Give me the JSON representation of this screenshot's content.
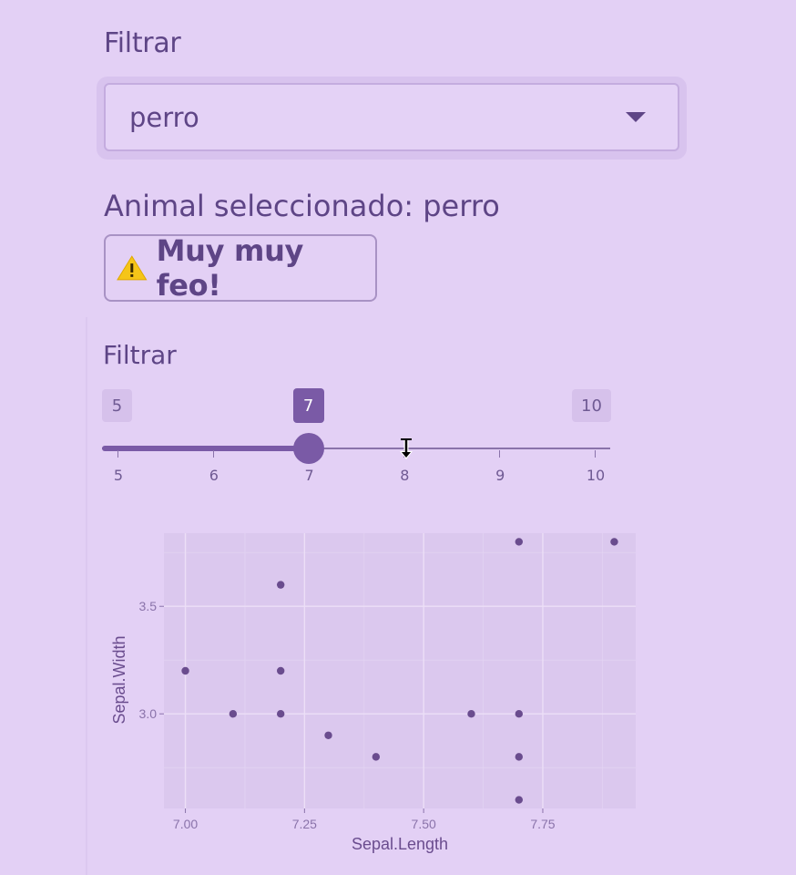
{
  "filter_select": {
    "label": "Filtrar",
    "value": "perro"
  },
  "status": {
    "text": "Animal seleccionado: perro"
  },
  "warning": {
    "icon": "warning-icon",
    "text": "Muy muy feo!"
  },
  "slider": {
    "label": "Filtrar",
    "min": 5,
    "max": 10,
    "value": 7,
    "min_label": "5",
    "max_label": "10",
    "value_label": "7",
    "ticks": [
      "5",
      "6",
      "7",
      "8",
      "9",
      "10"
    ]
  },
  "colors": {
    "background": "#e3d0f5",
    "accent": "#7a5aa6",
    "text": "#5e4586",
    "plot_panel": "#dbc8ee",
    "point": "#6a4c8e"
  },
  "chart_data": {
    "type": "scatter",
    "xlabel": "Sepal.Length",
    "ylabel": "Sepal.Width",
    "xlim": [
      6.955,
      7.945
    ],
    "ylim": [
      2.56,
      3.84
    ],
    "x_ticks": [
      "7.00",
      "7.25",
      "7.50",
      "7.75"
    ],
    "y_ticks": [
      "3.0",
      "3.5"
    ],
    "grid": true,
    "points": [
      {
        "x": 7.0,
        "y": 3.2
      },
      {
        "x": 7.1,
        "y": 3.0
      },
      {
        "x": 7.2,
        "y": 3.6
      },
      {
        "x": 7.2,
        "y": 3.2
      },
      {
        "x": 7.2,
        "y": 3.0
      },
      {
        "x": 7.3,
        "y": 2.9
      },
      {
        "x": 7.4,
        "y": 2.8
      },
      {
        "x": 7.6,
        "y": 3.0
      },
      {
        "x": 7.7,
        "y": 3.8
      },
      {
        "x": 7.7,
        "y": 3.0
      },
      {
        "x": 7.7,
        "y": 2.8
      },
      {
        "x": 7.7,
        "y": 2.6
      },
      {
        "x": 7.9,
        "y": 3.8
      }
    ]
  }
}
